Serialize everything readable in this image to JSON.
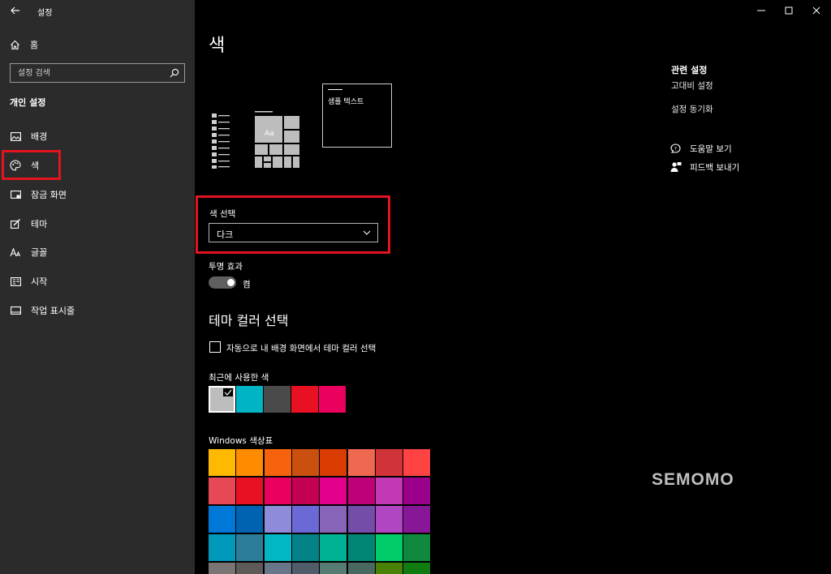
{
  "window": {
    "title": "설정"
  },
  "sidebar": {
    "home_label": "홈",
    "search_placeholder": "설정 검색",
    "section_title": "개인 설정",
    "items": [
      {
        "label": "배경",
        "icon": "image-icon"
      },
      {
        "label": "색",
        "icon": "palette-icon",
        "selected": true
      },
      {
        "label": "잠금 화면",
        "icon": "lock-screen-icon"
      },
      {
        "label": "테마",
        "icon": "theme-icon"
      },
      {
        "label": "글꼴",
        "icon": "font-icon"
      },
      {
        "label": "시작",
        "icon": "start-icon"
      },
      {
        "label": "작업 표시줄",
        "icon": "taskbar-icon"
      }
    ]
  },
  "main": {
    "title": "색",
    "sample_text": "샘플 텍스트",
    "preview_tile_text": "Aa",
    "color_choice_label": "색 선택",
    "color_choice_value": "다크",
    "transparency_label": "투명 효과",
    "transparency_state": "켬",
    "transparency_on": true,
    "theme_color_title": "테마 컬러 선택",
    "auto_pick_label": "자동으로 내 배경 화면에서 테마 컬러 선택",
    "auto_pick_checked": false,
    "recent_colors_label": "최근에 사용한 색",
    "recent_colors": [
      "#bdbdbd",
      "#00b4c5",
      "#4a4a4a",
      "#e81123",
      "#ea005e"
    ],
    "windows_palette_label": "Windows 색상표",
    "windows_palette": [
      [
        "#ffb900",
        "#ff8c00",
        "#f7630c",
        "#ca5010",
        "#da3b01",
        "#ef6950",
        "#d13438",
        "#ff4343"
      ],
      [
        "#e74856",
        "#e81123",
        "#ea005e",
        "#c30052",
        "#e3008c",
        "#bf0077",
        "#c239b3",
        "#9a0089"
      ],
      [
        "#0078d7",
        "#0063b1",
        "#8e8cd8",
        "#6b69d6",
        "#8764b8",
        "#744da9",
        "#b146c2",
        "#881798"
      ],
      [
        "#0099bc",
        "#2d7d9a",
        "#00b7c3",
        "#038387",
        "#00b294",
        "#018574",
        "#00cc6a",
        "#10893e"
      ],
      [
        "#7a7574",
        "#5d5a58",
        "#68768a",
        "#515c6b",
        "#567c73",
        "#486860",
        "#498205",
        "#107c10"
      ]
    ]
  },
  "related": {
    "title": "관련 설정",
    "links": [
      "고대비 설정",
      "설정 동기화"
    ],
    "help_label": "도움말 보기",
    "feedback_label": "피드백 보내기"
  },
  "watermark": "SEMOMO"
}
